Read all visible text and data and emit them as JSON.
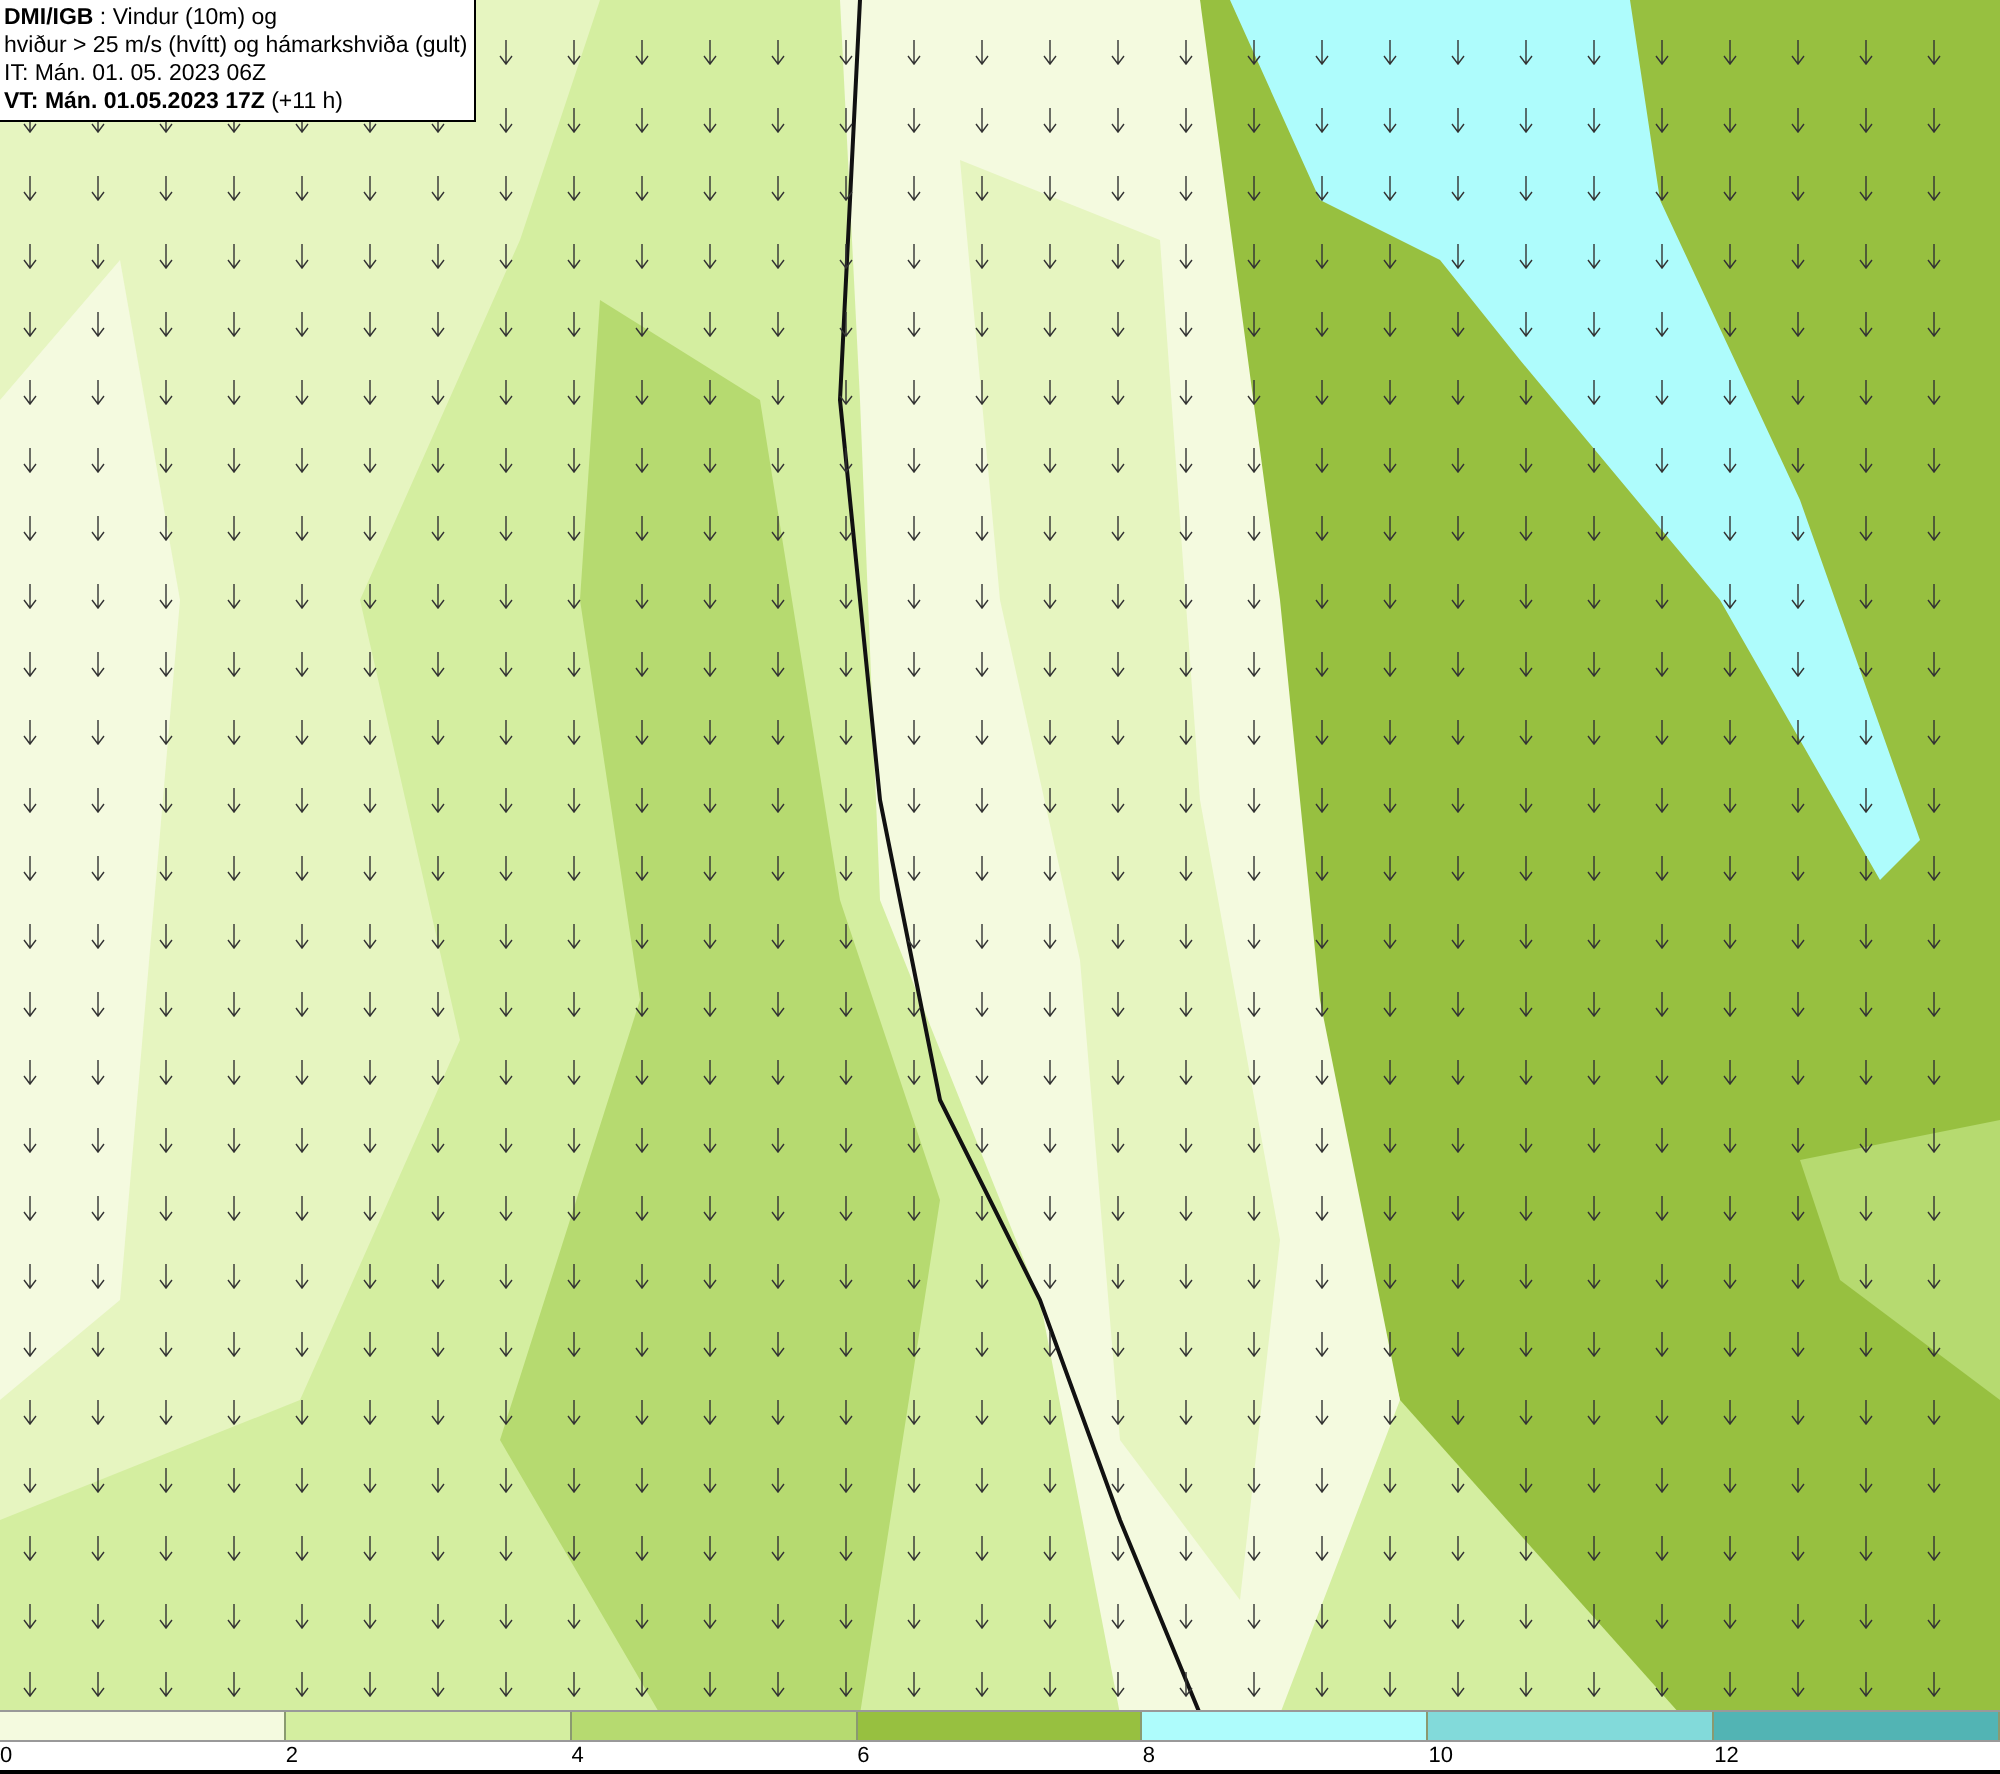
{
  "info_box": {
    "lines": [
      "**DMI/IGB** : Vindur (10m) og",
      "hviður > 25 m/s (hvítt) og hámarkshviða (gult)",
      "IT: Mán. 01. 05. 2023 06Z",
      "**VT: Mán. 01.05.2023 17Z** (+11 h)"
    ]
  },
  "legend": {
    "bins": [
      {
        "color": "#f4fadf",
        "label": "0"
      },
      {
        "color": "#d4eea0",
        "label": "2"
      },
      {
        "color": "#b6da70",
        "label": "4"
      },
      {
        "color": "#97c040",
        "label": "6"
      },
      {
        "color": "#aefcfc",
        "label": "8"
      },
      {
        "color": "#82dada",
        "label": "10"
      },
      {
        "color": "#52b4b4",
        "label": "12"
      }
    ]
  }
}
